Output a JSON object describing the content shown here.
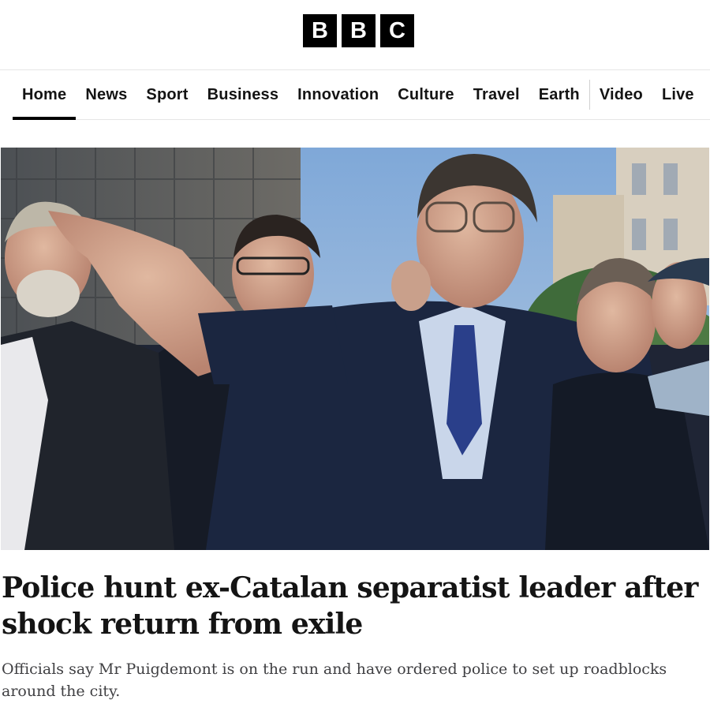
{
  "header": {
    "logo_letters": [
      "B",
      "B",
      "C"
    ]
  },
  "nav": {
    "items": [
      {
        "label": "Home",
        "active": true
      },
      {
        "label": "News"
      },
      {
        "label": "Sport"
      },
      {
        "label": "Business"
      },
      {
        "label": "Innovation"
      },
      {
        "label": "Culture"
      },
      {
        "label": "Travel"
      },
      {
        "label": "Earth"
      },
      {
        "label": "Video"
      },
      {
        "label": "Live"
      }
    ]
  },
  "story": {
    "headline": "Police hunt ex-Catalan separatist leader after shock return from exile",
    "summary": "Officials say Mr Puigdemont is on the run and have ordered police to set up roadblocks around the city."
  },
  "colors": {
    "logo_block": "#000000",
    "text": "#141414",
    "summary_text": "#3f3f42",
    "divider": "#e6e6e6"
  }
}
